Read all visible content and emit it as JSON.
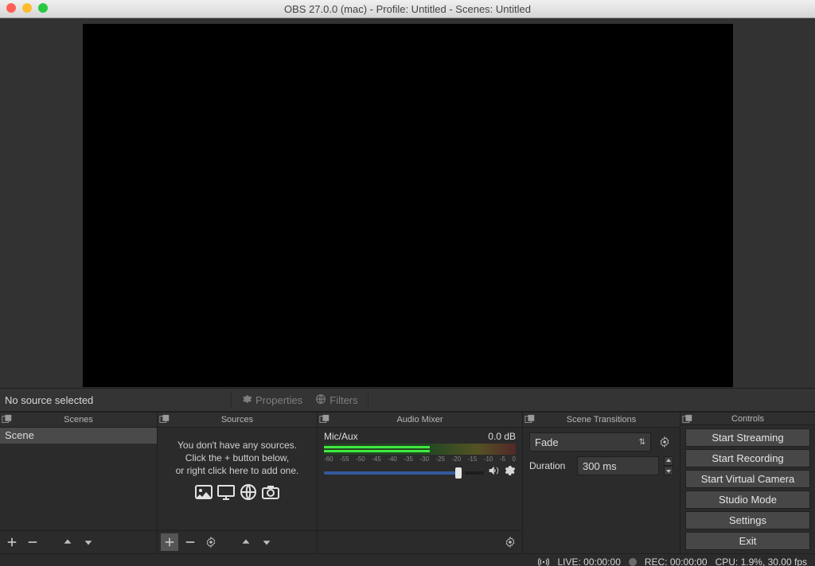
{
  "window": {
    "title": "OBS 27.0.0 (mac) - Profile: Untitled - Scenes: Untitled"
  },
  "source_toolbar": {
    "status": "No source selected",
    "properties_label": "Properties",
    "filters_label": "Filters"
  },
  "docks": {
    "scenes": {
      "title": "Scenes",
      "items": [
        "Scene"
      ]
    },
    "sources": {
      "title": "Sources",
      "empty_line1": "You don't have any sources.",
      "empty_line2": "Click the + button below,",
      "empty_line3": "or right click here to add one."
    },
    "mixer": {
      "title": "Audio Mixer",
      "channels": [
        {
          "name": "Mic/Aux",
          "level": "0.0 dB"
        }
      ],
      "ticks": [
        "-60",
        "-55",
        "-50",
        "-45",
        "-40",
        "-35",
        "-30",
        "-25",
        "-20",
        "-15",
        "-10",
        "-5",
        "0"
      ]
    },
    "transitions": {
      "title": "Scene Transitions",
      "selected": "Fade",
      "duration_label": "Duration",
      "duration_value": "300 ms"
    },
    "controls": {
      "title": "Controls",
      "buttons": [
        "Start Streaming",
        "Start Recording",
        "Start Virtual Camera",
        "Studio Mode",
        "Settings",
        "Exit"
      ]
    }
  },
  "status": {
    "live": "LIVE: 00:00:00",
    "rec": "REC: 00:00:00",
    "cpu": "CPU: 1.9%, 30.00 fps"
  }
}
